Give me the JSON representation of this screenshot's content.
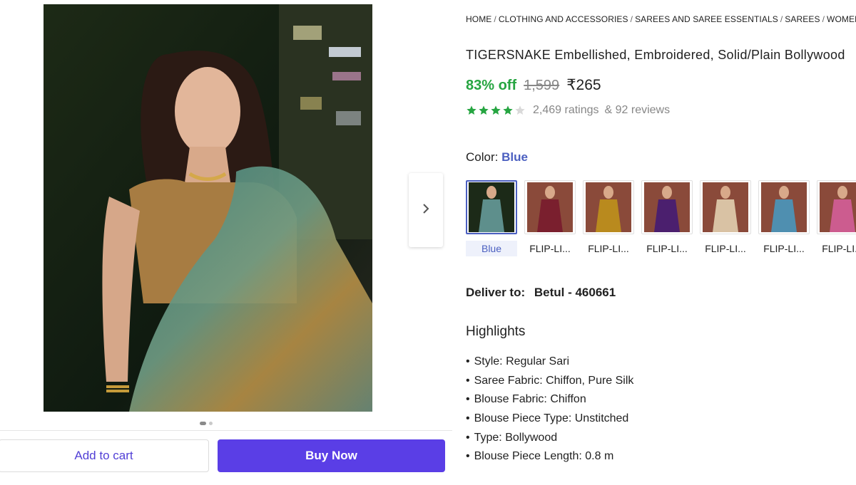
{
  "gallery": {
    "active_image": 1,
    "image_count": 2,
    "add_to_cart_label": "Add to cart",
    "buy_now_label": "Buy Now"
  },
  "breadcrumb": [
    "Home",
    "Clothing and Accessories",
    "Sarees and Saree Essentials",
    "Sarees",
    "Women's"
  ],
  "product": {
    "title": "TIGERSNAKE Embellished, Embroidered, Solid/Plain Bollywood",
    "discount": "83% off",
    "mrp": "1,599",
    "price": "₹265",
    "rating_stars": 4,
    "ratings": "2,469 ratings",
    "reviews": "& 92 reviews"
  },
  "color": {
    "label": "Color:",
    "selected": "Blue",
    "options": [
      {
        "name": "Blue",
        "swatch": "#5e8f8c"
      },
      {
        "name": "FLIP-LI...",
        "swatch": "#7a1f2e"
      },
      {
        "name": "FLIP-LI...",
        "swatch": "#b98a1e"
      },
      {
        "name": "FLIP-LI...",
        "swatch": "#4b1f6e"
      },
      {
        "name": "FLIP-LI...",
        "swatch": "#d9c2a4"
      },
      {
        "name": "FLIP-LI...",
        "swatch": "#4f8fb0"
      },
      {
        "name": "FLIP-LI...",
        "swatch": "#cc5c8f"
      }
    ]
  },
  "delivery": {
    "label": "Deliver to:",
    "location": "Betul - 460661"
  },
  "highlights": {
    "title": "Highlights",
    "items": [
      "Style: Regular Sari",
      "Saree Fabric: Chiffon, Pure Silk",
      "Blouse Fabric: Chiffon",
      "Blouse Piece Type: Unstitched",
      "Type: Bollywood",
      "Blouse Piece Length: 0.8 m"
    ]
  },
  "colors": {
    "accent": "#5a3ee6",
    "discount": "#26a541",
    "star": "#26a541",
    "link": "#4b5fc0"
  }
}
